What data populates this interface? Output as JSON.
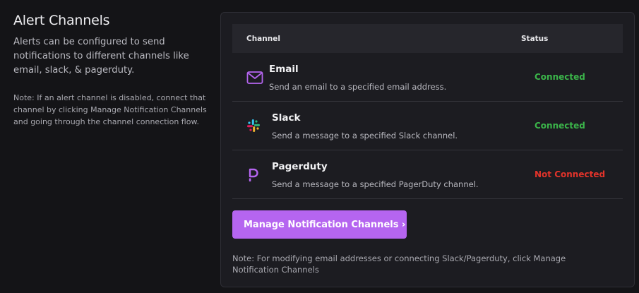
{
  "sidebar": {
    "title": "Alert Channels",
    "description": "Alerts can be configured to send notifications to different channels like email, slack, & pagerduty.",
    "note": "Note: If an alert channel is disabled, connect that channel by clicking Manage Notification Channels and going through the channel connection flow."
  },
  "table": {
    "headers": {
      "channel": "Channel",
      "status": "Status"
    },
    "rows": [
      {
        "name": "Email",
        "description": "Send an email to a specified email address.",
        "status": "Connected",
        "icon": "mail-icon"
      },
      {
        "name": "Slack",
        "description": "Send a message to a specified Slack channel.",
        "status": "Connected",
        "icon": "slack-icon"
      },
      {
        "name": "Pagerduty",
        "description": "Send a message to a specified PagerDuty channel.",
        "status": "Not Connected",
        "icon": "pagerduty-icon"
      }
    ]
  },
  "manage_button": {
    "label": "Manage Notification Channels ›"
  },
  "footnote": "Note: For modifying email addresses or connecting Slack/Pagerduty, click Manage Notification Channels",
  "colors": {
    "accent": "#b565f0",
    "connected": "#3bb54a",
    "not_connected": "#e2332a"
  }
}
